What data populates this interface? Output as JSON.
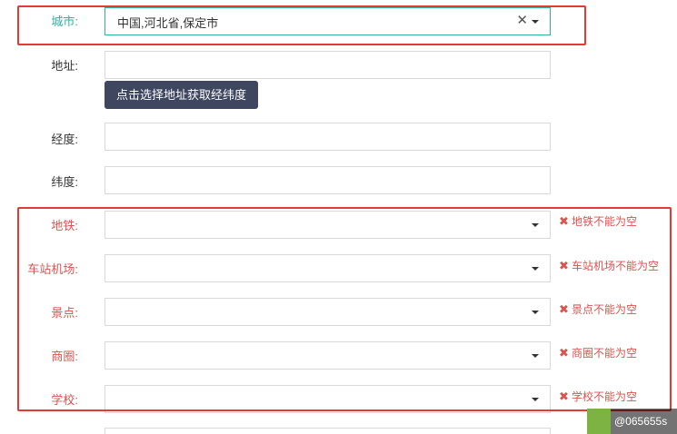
{
  "form": {
    "city": {
      "label": "城市:",
      "value": "中国,河北省,保定市",
      "clear_icon": "✕"
    },
    "address": {
      "label": "地址:",
      "value": "",
      "locate_button": "点击选择地址获取经纬度"
    },
    "longitude": {
      "label": "经度:",
      "value": ""
    },
    "latitude": {
      "label": "纬度:",
      "value": ""
    },
    "subway": {
      "label": "地铁:",
      "value": "",
      "error": "地铁不能为空"
    },
    "station_airport": {
      "label": "车站机场:",
      "value": "",
      "error": "车站机场不能为空"
    },
    "scenic": {
      "label": "景点:",
      "value": "",
      "error": "景点不能为空"
    },
    "business_district": {
      "label": "商圈:",
      "value": "",
      "error": "商圈不能为空"
    },
    "school": {
      "label": "学校:",
      "value": "",
      "error": "学校不能为空"
    }
  },
  "icons": {
    "error_icon": "✖",
    "dropdown_icon": "caret-down-icon"
  },
  "watermark": {
    "text": "@065655s"
  },
  "colors": {
    "label_active": "#2bb3a3",
    "error": "#d9534f",
    "highlight": "#e53935",
    "button_bg": "#3f4660"
  }
}
